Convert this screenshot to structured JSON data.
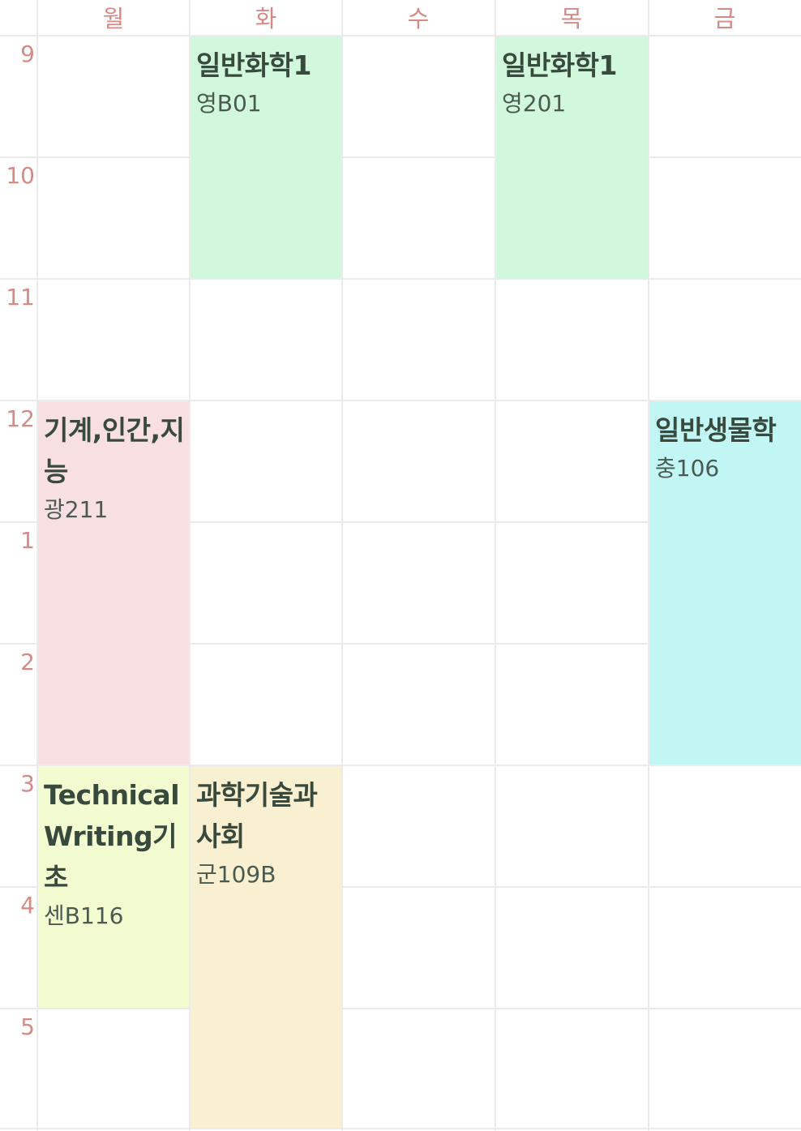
{
  "days": [
    "월",
    "화",
    "수",
    "목",
    "금"
  ],
  "hours": [
    "9",
    "10",
    "11",
    "12",
    "1",
    "2",
    "3",
    "4",
    "5"
  ],
  "courses": [
    {
      "title": "일반화학1",
      "room": "영B01",
      "color": "#d1f8dc"
    },
    {
      "title": "일반화학1",
      "room": "영201",
      "color": "#d1f8dc"
    },
    {
      "title": "기계,인간,지능",
      "room": "광211",
      "color": "#f8e0e2"
    },
    {
      "title": "일반생물학",
      "room": "충106",
      "color": "#c1f6f5"
    },
    {
      "title": "Technical Writing기초",
      "room": "센B116",
      "color": "#f3fbd0"
    },
    {
      "title": "과학기술과사회",
      "room": "군109B",
      "color": "#f8f0d0"
    }
  ]
}
